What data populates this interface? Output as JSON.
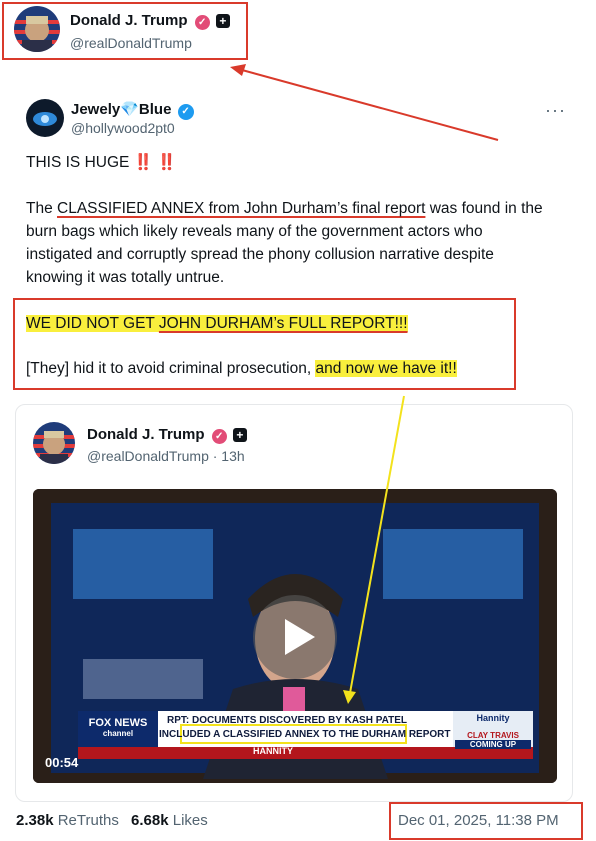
{
  "top_user": {
    "name": "Donald J. Trump",
    "handle": "@realDonaldTrump",
    "avatar_icon": "flag-portrait-avatar",
    "verified_icon": "pink-verified-badge-icon",
    "plus_icon": "plus-badge-icon"
  },
  "post": {
    "author_name": "Jewely",
    "author_suffix": "Blue",
    "diamond_icon": "blue-diamond-icon",
    "handle": "@hollywood2pt0",
    "more_label": "···",
    "headline": "THIS IS HUGE",
    "headline_marks": "‼️ ‼️",
    "para1_prefix": "The ",
    "para1_underlined": "CLASSIFIED ANNEX from John Durham’s final report",
    "para1_rest": " was found in the burn bags which likely reveals many of the government actors who instigated and corruptly spread the phony collusion narrative despite knowing it was totally untrue.",
    "line2_a": "WE DID NOT GET ",
    "line2_b": "JOHN DURHAM’s FULL REPORT!!!",
    "line3_a": "[They] hid it to avoid criminal prosecution, ",
    "line3_b": "and now we have it!!"
  },
  "quoted": {
    "name": "Donald J. Trump",
    "handle": "@realDonaldTrump",
    "time": "· 13h",
    "video_duration": "00:54",
    "chyron_line1": "RPT: DOCUMENTS DISCOVERED BY KASH PATEL",
    "chyron_line2a": "INCLUDED ",
    "chyron_line2b": "A CLASSIFIED ANNEX TO THE DURHAM REPORT",
    "show_name": "HANNITY",
    "network": "FOX NEWS",
    "network_sub": "channel",
    "promo_show": "Hannity",
    "promo_guest": "CLAY TRAVIS",
    "promo_status": "COMING UP"
  },
  "footer": {
    "retruths_count": "2.38k",
    "retruths_label": "ReTruths",
    "likes_count": "6.68k",
    "likes_label": "Likes",
    "timestamp": "Dec 01, 2025, 11:38 PM"
  },
  "colors": {
    "annotation_red": "#d93a2b",
    "highlight_yellow": "#f9ef3d",
    "arrow_yellow": "#f3e21c",
    "text_gray": "#536471"
  }
}
